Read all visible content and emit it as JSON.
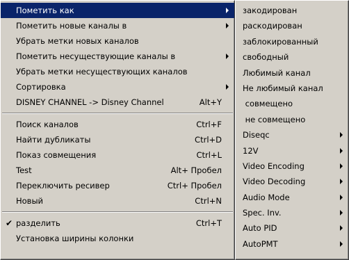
{
  "main_menu": {
    "items": [
      {
        "label": "Пометить как",
        "shortcut": "",
        "submenu": true,
        "checked": false,
        "selected": true
      },
      {
        "label": "Пометить новые каналы в",
        "shortcut": "",
        "submenu": true,
        "checked": false
      },
      {
        "label": "Убрать метки новых каналов",
        "shortcut": "",
        "submenu": false,
        "checked": false
      },
      {
        "label": "Пометить несуществующие каналы в",
        "shortcut": "",
        "submenu": true,
        "checked": false
      },
      {
        "label": "Убрать метки несуществующих каналов",
        "shortcut": "",
        "submenu": false,
        "checked": false
      },
      {
        "label": "Сортировка",
        "shortcut": "",
        "submenu": true,
        "checked": false
      },
      {
        "label": "DISNEY CHANNEL -> Disney Channel",
        "shortcut": "Alt+Y",
        "submenu": false,
        "checked": false
      },
      {
        "separator": true
      },
      {
        "label": "Поиск каналов",
        "shortcut": "Ctrl+F",
        "submenu": false,
        "checked": false
      },
      {
        "label": "Найти дубликаты",
        "shortcut": "Ctrl+D",
        "submenu": false,
        "checked": false
      },
      {
        "label": "Показ совмещения",
        "shortcut": "Ctrl+L",
        "submenu": false,
        "checked": false
      },
      {
        "label": "Test",
        "shortcut": "Alt+ Пробел",
        "submenu": false,
        "checked": false
      },
      {
        "label": "Переключить ресивер",
        "shortcut": "Ctrl+ Пробел",
        "submenu": false,
        "checked": false
      },
      {
        "label": "Новый",
        "shortcut": "Ctrl+N",
        "submenu": false,
        "checked": false
      },
      {
        "separator": true
      },
      {
        "label": "разделить",
        "shortcut": "Ctrl+T",
        "submenu": false,
        "checked": true
      },
      {
        "label": "Установка ширины колонки",
        "shortcut": "",
        "submenu": false,
        "checked": false
      }
    ],
    "check_glyph": "✔"
  },
  "sub_menu": {
    "items": [
      {
        "label": "закодирован",
        "submenu": false
      },
      {
        "label": "раскодирован",
        "submenu": false
      },
      {
        "label": "заблокированный",
        "submenu": false
      },
      {
        "label": "свободный",
        "submenu": false
      },
      {
        "label": "Любимый канал",
        "submenu": false
      },
      {
        "label": "Не любимый канал",
        "submenu": false
      },
      {
        "label": " совмещено",
        "submenu": false
      },
      {
        "label": " не совмещено",
        "submenu": false
      },
      {
        "label": "Diseqc",
        "submenu": true
      },
      {
        "label": "12V",
        "submenu": true
      },
      {
        "label": "Video Encoding",
        "submenu": true
      },
      {
        "label": "Video Decoding",
        "submenu": true
      },
      {
        "label": "Audio Mode",
        "submenu": true
      },
      {
        "label": "Spec. Inv.",
        "submenu": true
      },
      {
        "label": "Auto PID",
        "submenu": true
      },
      {
        "label": "AutoPMT",
        "submenu": true
      }
    ]
  },
  "colors": {
    "menu_bg": "#d4d0c8",
    "highlight": "#0a246a"
  }
}
